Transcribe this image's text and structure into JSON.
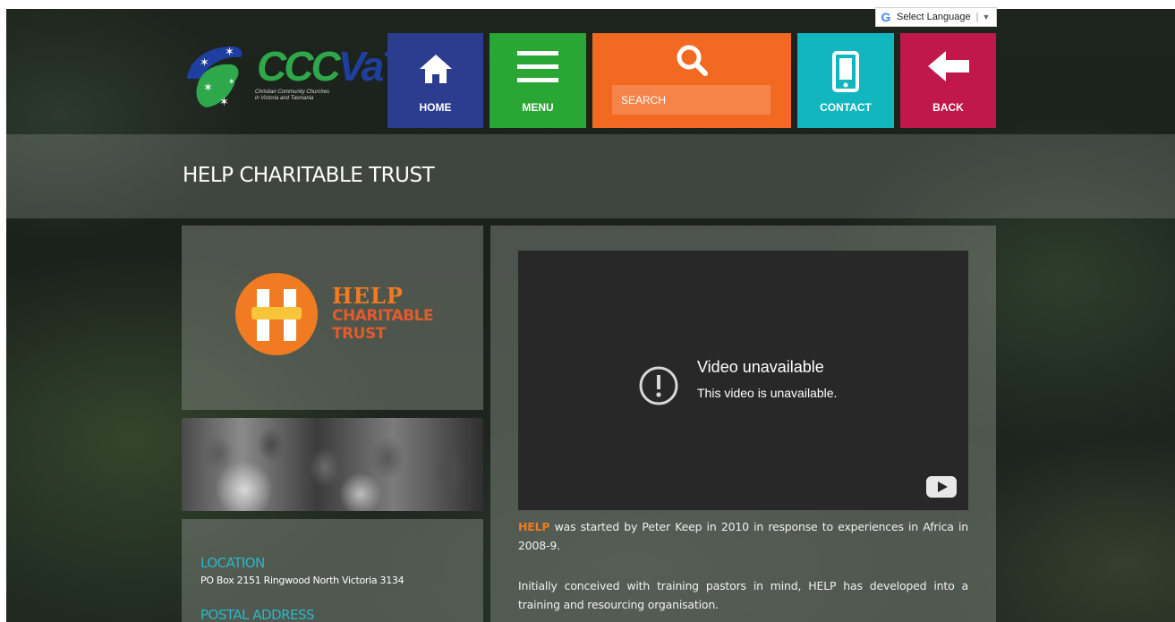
{
  "translate": {
    "label": "Select Language",
    "g": "G",
    "arrow": "▼"
  },
  "logo": {
    "name_ccc": "CCC",
    "name_vat": "VaT",
    "tagline_1": "Christian Community Churches",
    "tagline_2": "in Victoria and Tasmania"
  },
  "nav": {
    "home": "HOME",
    "menu": "MENU",
    "search_placeholder": "SEARCH",
    "contact": "CONTACT",
    "back": "BACK"
  },
  "page_title": "HELP CHARITABLE TRUST",
  "help_logo": {
    "line1": "HELP",
    "line2": "CHARITABLE",
    "line3": "TRUST"
  },
  "info": {
    "location_heading": "LOCATION",
    "location_value": "PO Box 2151 Ringwood North Victoria 3134",
    "postal_heading": "POSTAL ADDRESS"
  },
  "video": {
    "title": "Video unavailable",
    "subtitle": "This video is unavailable."
  },
  "body": {
    "p1_brand": "HELP",
    "p1_rest": " was started by Peter Keep in 2010 in response to experiences in Africa in 2008-9.",
    "p2": "Initially conceived with training pastors in mind, HELP has developed into a training and resourcing organisation."
  },
  "colors": {
    "home": "#2c3d8f",
    "menu": "#2aa634",
    "search": "#f26a21",
    "contact": "#11b6bf",
    "back": "#c0184a",
    "accent": "#2ab8c8",
    "brand_orange": "#f07b22"
  }
}
